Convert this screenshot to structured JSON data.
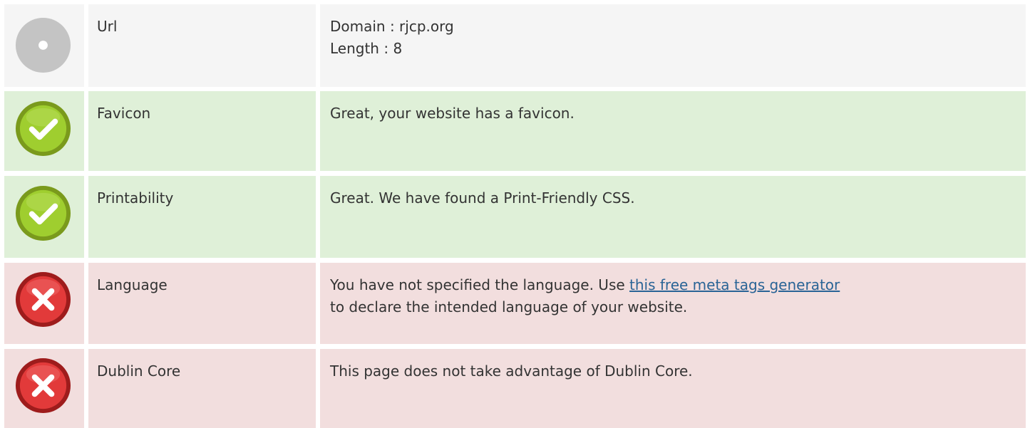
{
  "rows": [
    {
      "status": "neutral",
      "icon": "neutral-circle-icon",
      "name": "Url",
      "lines": [
        "Domain : rjcp.org",
        "Length : 8"
      ]
    },
    {
      "status": "good",
      "icon": "check-circle-icon",
      "name": "Favicon",
      "text": "Great, your website has a favicon."
    },
    {
      "status": "good",
      "icon": "check-circle-icon",
      "name": "Printability",
      "text": "Great. We have found a Print-Friendly CSS."
    },
    {
      "status": "bad",
      "icon": "x-circle-icon",
      "name": "Language",
      "text_before": "You have not specified the language. Use ",
      "link_text": "this free meta tags generator",
      "text_after": "to declare the intended language of your website."
    },
    {
      "status": "bad",
      "icon": "x-circle-icon",
      "name": "Dublin Core",
      "text": "This page does not take advantage of Dublin Core."
    }
  ],
  "colors": {
    "neutral_bg": "#f5f5f5",
    "good_bg": "#dff0d8",
    "bad_bg": "#f2dede",
    "link": "#2a6496"
  }
}
